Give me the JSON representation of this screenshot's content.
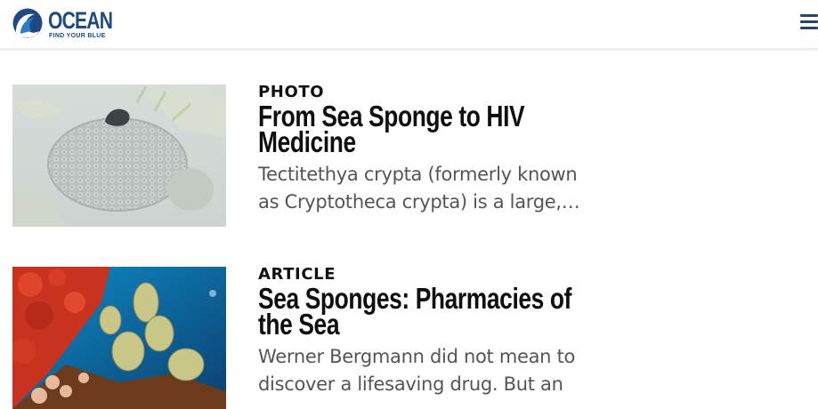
{
  "colors": {
    "brand": "#1d4a82",
    "brand_light": "#2e7cc4",
    "label": "#111111",
    "title": "#0f0f0f",
    "excerpt": "#555555",
    "menu": "#23466f"
  },
  "header": {
    "logo": {
      "title": "OCEAN",
      "tagline": "FIND YOUR BLUE",
      "icon": "wave-logo-icon"
    },
    "menu_icon": "hamburger-menu-icon"
  },
  "articles": [
    {
      "type": "PHOTO",
      "title": "From Sea Sponge to HIV Medicine",
      "excerpt": "Tectitethya crypta (formerly known as Cryptotheca crypta) is a large,…",
      "image": "sea-sponge-photo"
    },
    {
      "type": "ARTICLE",
      "title": "Sea Sponges: Pharmacies of the Sea",
      "excerpt": "Werner Bergmann did not mean to discover a lifesaving drug. But an",
      "image": "coral-reef-photo"
    }
  ]
}
